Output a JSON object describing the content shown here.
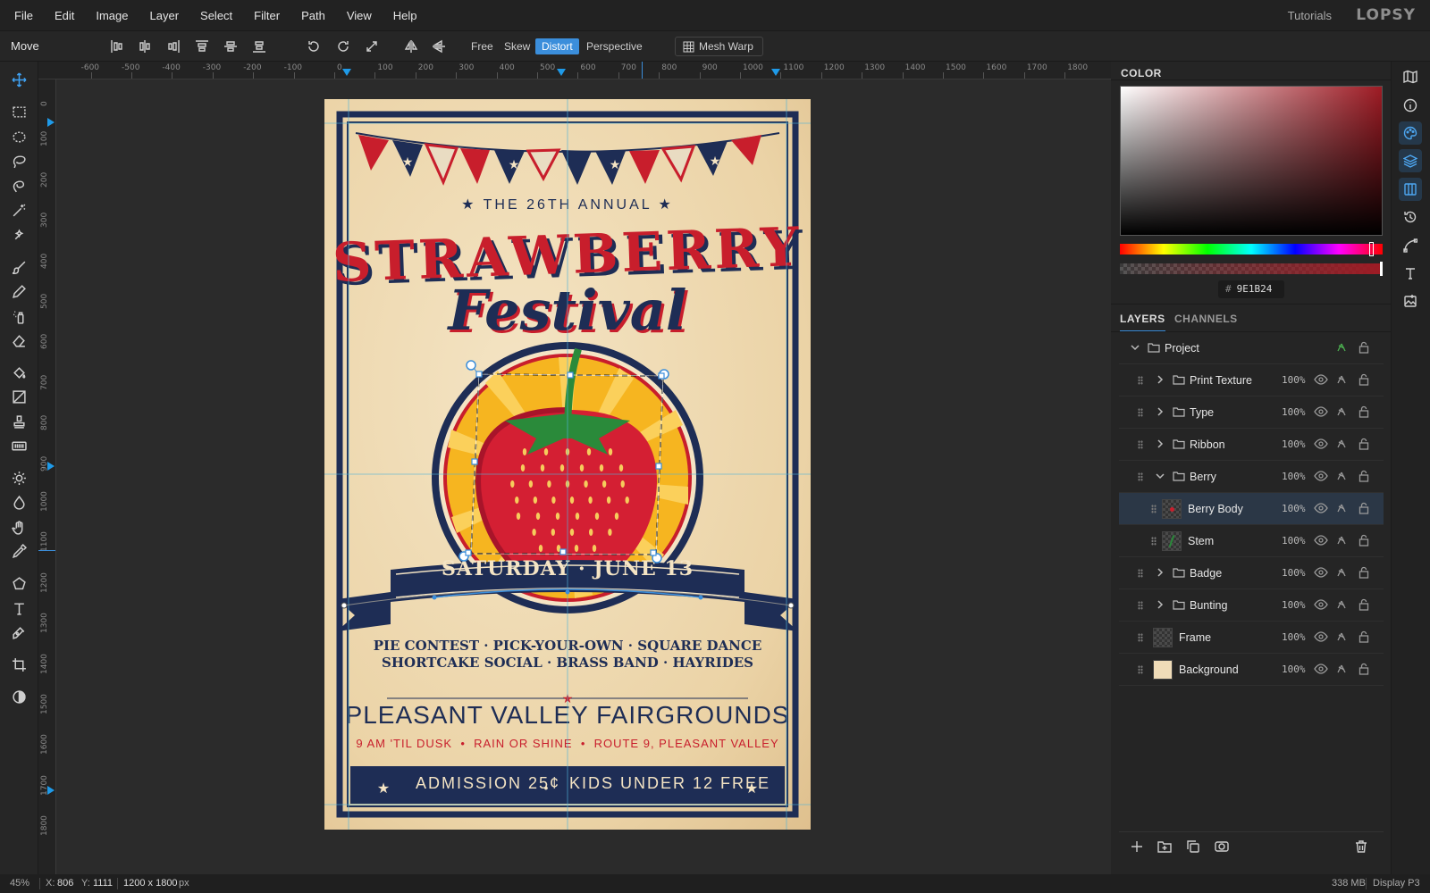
{
  "menu": [
    "File",
    "Edit",
    "Image",
    "Layer",
    "Select",
    "Filter",
    "Path",
    "View",
    "Help"
  ],
  "header": {
    "tutorials": "Tutorials",
    "logo": "LOPSY"
  },
  "options": {
    "tool_name": "Move",
    "modes": [
      "Free",
      "Skew",
      "Distort",
      "Perspective"
    ],
    "active_mode": "Distort",
    "mesh_warp": "Mesh Warp"
  },
  "ruler": {
    "top": [
      "-600",
      "-500",
      "-400",
      "-300",
      "-200",
      "-100",
      "0",
      "100",
      "200",
      "300",
      "400",
      "500",
      "600",
      "700",
      "800",
      "900",
      "1000",
      "1100",
      "1200",
      "1300",
      "1400",
      "1500",
      "1600",
      "1700",
      "1800"
    ],
    "left": [
      "0",
      "100",
      "200",
      "300",
      "400",
      "500",
      "600",
      "700",
      "800",
      "900",
      "1000",
      "1100",
      "1200",
      "1300",
      "1400",
      "1500",
      "1600",
      "1700",
      "1800"
    ]
  },
  "poster": {
    "annual": "★ THE 26TH ANNUAL ★",
    "title1": "STRAWBERRY",
    "title2": "Festival",
    "date": "SATURDAY · JUNE 13",
    "activities1": "PIE CONTEST · PICK-YOUR-OWN · SQUARE DANCE",
    "activities2": "SHORTCAKE SOCIAL · BRASS BAND · HAYRIDES",
    "venue": "PLEASANT VALLEY FAIRGROUNDS",
    "details": "9 AM 'TIL DUSK  •  RAIN OR SHINE  •  ROUTE 9, PLEASANT VALLEY",
    "admission": "ADMISSION 25¢",
    "kids": "KIDS UNDER 12 FREE"
  },
  "color_panel": {
    "title": "COLOR",
    "hex": "9E1B24",
    "hash": "#"
  },
  "layers_panel": {
    "tabs": [
      "LAYERS",
      "CHANNELS"
    ],
    "project": "Project",
    "layers": [
      {
        "name": "Print Texture",
        "opacity": "100%"
      },
      {
        "name": "Type",
        "opacity": "100%"
      },
      {
        "name": "Ribbon",
        "opacity": "100%"
      },
      {
        "name": "Berry",
        "opacity": "100%"
      },
      {
        "name": "Berry Body",
        "opacity": "100%"
      },
      {
        "name": "Stem",
        "opacity": "100%"
      },
      {
        "name": "Badge",
        "opacity": "100%"
      },
      {
        "name": "Bunting",
        "opacity": "100%"
      },
      {
        "name": "Frame",
        "opacity": "100%"
      },
      {
        "name": "Background",
        "opacity": "100%"
      }
    ],
    "selected": "Berry Body"
  },
  "status": {
    "zoom": "45%",
    "x_label": "X:",
    "x": "806",
    "y_label": "Y:",
    "y": "1111",
    "size": "1200 x 1800",
    "unit": "px",
    "memory": "338 MB",
    "profile": "Display P3"
  },
  "colors": {
    "accent": "#3b8edb",
    "navy": "#1e2d55",
    "red": "#c81e2c",
    "swatch": "#9e1b24"
  }
}
